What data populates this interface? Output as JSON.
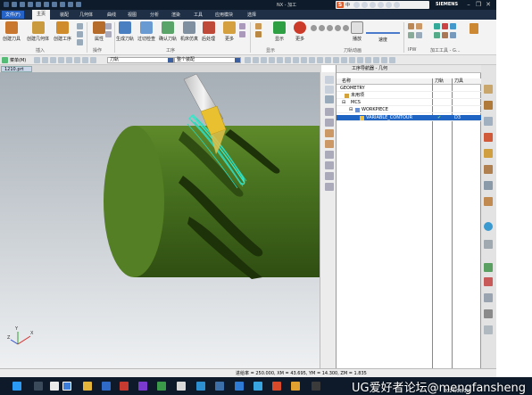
{
  "window": {
    "title": "NX - 加工",
    "brand": "SIEMENS"
  },
  "ime": {
    "label": "中"
  },
  "menu": [
    "文件(F)",
    "主页",
    "装配",
    "几何体",
    "曲线",
    "视图",
    "分析",
    "渲染",
    "工具",
    "应用模块",
    "选择"
  ],
  "ribbon": {
    "buttons": [
      "创建刀具",
      "创建几何体",
      "创建工序",
      "属性",
      "生成刀轨",
      "过切检查",
      "确认刀轨",
      "机床仿真",
      "后处理",
      "更多",
      "显示",
      "显示面",
      "更多",
      "播放"
    ],
    "groups": [
      "插入",
      "操作",
      "工序",
      "显示",
      "刀轨动画",
      "IPW",
      "加工工具 - G..."
    ],
    "speed_label": "速度"
  },
  "filter": {
    "menu": "菜单(M)",
    "type_value": "刀轨",
    "scope_value": "整个装配"
  },
  "tab": {
    "label": "1210.prt"
  },
  "navigator": {
    "title": "工序导航器 - 几何",
    "columns": [
      "名称",
      "刀轨",
      "刀具"
    ],
    "rows": [
      {
        "name": "GEOMETRY",
        "path": "",
        "tool": ""
      },
      {
        "name": "未用项",
        "path": "",
        "tool": ""
      },
      {
        "name": "MCS",
        "path": "",
        "tool": ""
      },
      {
        "name": "WORKPIECE",
        "path": "",
        "tool": ""
      },
      {
        "name": "VARIABLE_CONTOUR",
        "path": "✔",
        "tool": "D3"
      }
    ]
  },
  "status": {
    "text": "进给率 = 250.000, XM = 43.695, YM = 14.300, ZM = 1.835"
  },
  "watermark": {
    "text": "UG爱好者论坛@mengfansheng"
  },
  "clock": {
    "date": "2024/08/19"
  },
  "axes": {
    "x": "X",
    "y": "Y",
    "z": "Z"
  }
}
